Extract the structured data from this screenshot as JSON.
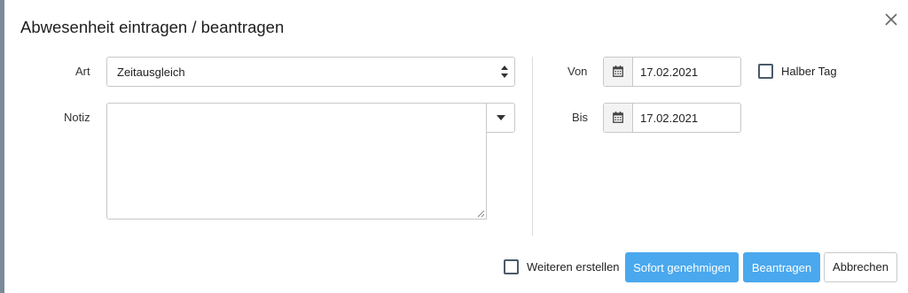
{
  "dialog": {
    "title": "Abwesenheit eintragen / beantragen",
    "close_icon": "close-icon"
  },
  "form": {
    "art": {
      "label": "Art",
      "value": "Zeitausgleich"
    },
    "notiz": {
      "label": "Notiz",
      "value": ""
    },
    "von": {
      "label": "Von",
      "value": "17.02.2021",
      "icon": "calendar-icon"
    },
    "bis": {
      "label": "Bis",
      "value": "17.02.2021",
      "icon": "calendar-icon"
    },
    "halber_tag": {
      "label": "Halber Tag",
      "checked": false
    }
  },
  "footer": {
    "weiteren_erstellen": {
      "label": "Weiteren erstellen",
      "checked": false
    },
    "sofort_genehmigen_label": "Sofort genehmigen",
    "beantragen_label": "Beantragen",
    "abbrechen_label": "Abbrechen"
  },
  "colors": {
    "primary": "#4aa8ee",
    "border": "#c8c8c8",
    "addon_bg": "#f3f3f3",
    "backdrop_stripe": "#7a8a99"
  }
}
